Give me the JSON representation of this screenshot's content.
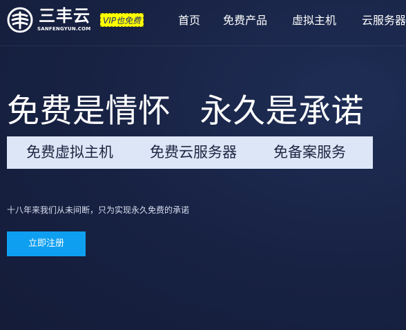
{
  "header": {
    "logo": {
      "name": "三丰云",
      "subtitle": "SANFENGYUN.COM"
    },
    "vip_badge": "VIP也免费",
    "nav": [
      {
        "label": "首页"
      },
      {
        "label": "免费产品"
      },
      {
        "label": "虚拟主机"
      },
      {
        "label": "云服务器"
      }
    ]
  },
  "hero": {
    "title_left": "免费是情怀",
    "title_right": "永久是承诺",
    "features": [
      {
        "label": "免费虚拟主机"
      },
      {
        "label": "免费云服务器"
      },
      {
        "label": "免备案服务"
      }
    ],
    "tagline": "十八年来我们从未间断，只为实现永久免费的承诺",
    "register_label": "立即注册"
  },
  "colors": {
    "background": "#172142",
    "accent_button": "#0f9ff0",
    "vip_badge_bg": "#ffff00",
    "feature_bar_bg": "#dde6f7"
  },
  "icons": {
    "logo_mark": "sanfengyun-logo-icon"
  }
}
